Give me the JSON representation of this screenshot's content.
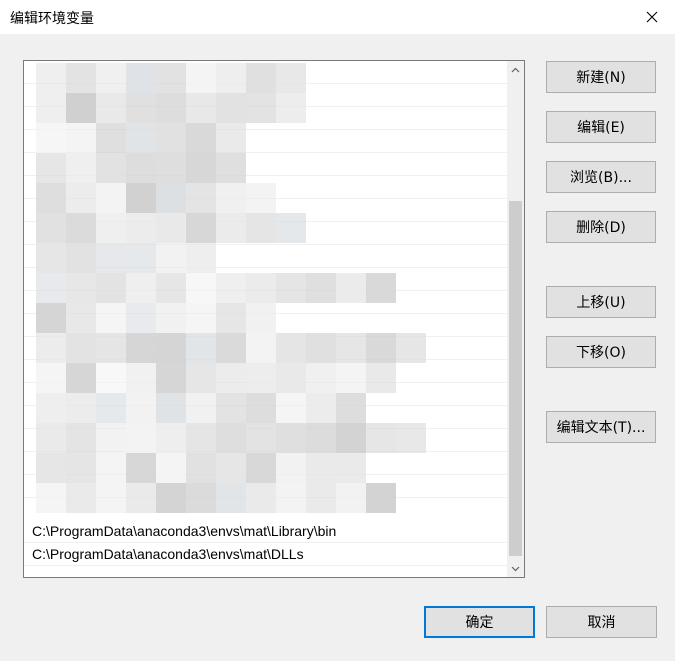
{
  "window": {
    "title": "编辑环境变量"
  },
  "paths": {
    "visible": [
      "C:\\ProgramData\\anaconda3\\envs\\mat\\Library\\bin",
      "C:\\ProgramData\\anaconda3\\envs\\mat\\DLLs"
    ]
  },
  "buttons": {
    "new": "新建(N)",
    "edit": "编辑(E)",
    "browse": "浏览(B)...",
    "delete": "删除(D)",
    "move_up": "上移(U)",
    "move_down": "下移(O)",
    "edit_text": "编辑文本(T)...",
    "ok": "确定",
    "cancel": "取消"
  },
  "icons": {
    "close": "close-icon",
    "scroll_up": "chevron-up-icon",
    "scroll_down": "chevron-down-icon"
  },
  "colors": {
    "accent": "#0078d7",
    "button_bg": "#e1e1e1",
    "dialog_bg": "#f0f0f0"
  }
}
